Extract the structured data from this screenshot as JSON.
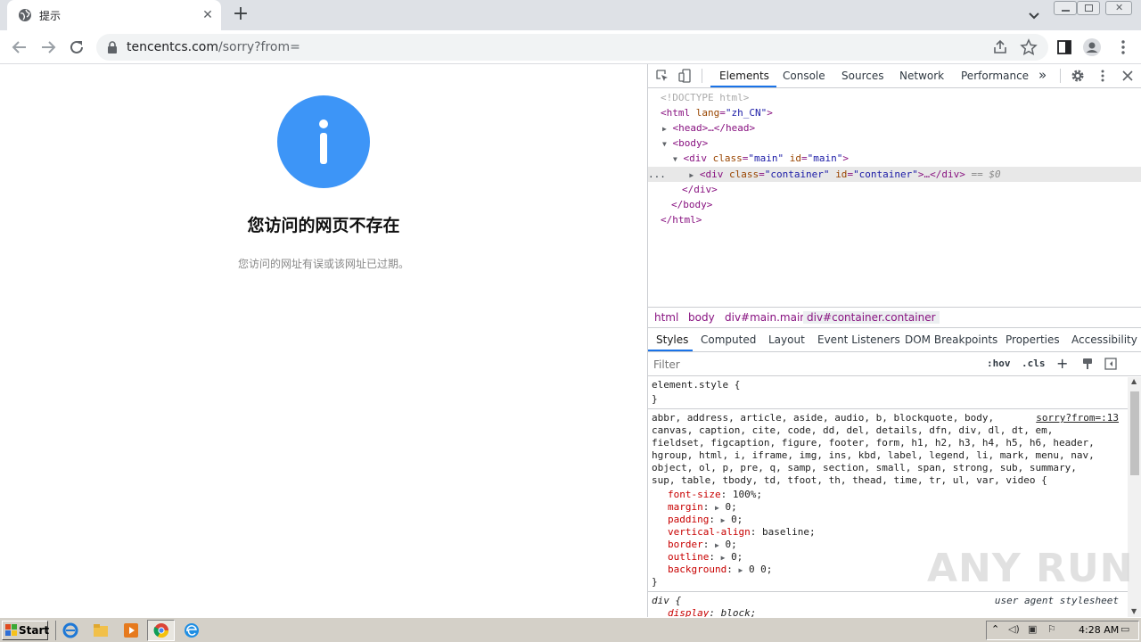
{
  "browser": {
    "tab_title": "提示",
    "url_host": "tencentcs.com",
    "url_rest": "/sorry?from="
  },
  "page": {
    "heading": "您访问的网页不存在",
    "subtext": "您访问的网址有误或该网址已过期。",
    "info_icon_color": "#3d95f7"
  },
  "devtools": {
    "tabs": [
      "Elements",
      "Console",
      "Sources",
      "Network",
      "Performance"
    ],
    "more_tabs": "»",
    "dom": {
      "doctype": "<!DOCTYPE html>",
      "html_open_tag": "html",
      "html_attr_name": "lang",
      "html_attr_value": "\"zh_CN\"",
      "head_line": "<head>…</head>",
      "body_open": "<body>",
      "main_tag": "div",
      "main_class_name": "class",
      "main_class_value": "\"main\"",
      "main_id_name": "id",
      "main_id_value": "\"main\"",
      "container_tag": "div",
      "container_class_value": "\"container\"",
      "container_id_value": "\"container\"",
      "container_suffix": ">…</div>",
      "selected_marker": "== $0",
      "ellipsis": "...",
      "div_close": "</div>",
      "body_close": "</body>",
      "html_close": "</html>"
    },
    "breadcrumbs": [
      "html",
      "body",
      "div#main.main",
      "div#container.container"
    ],
    "subtabs": [
      "Styles",
      "Computed",
      "Layout",
      "Event Listeners",
      "DOM Breakpoints",
      "Properties",
      "Accessibility"
    ],
    "filter_placeholder": "Filter",
    "hov": ":hov",
    "cls": ".cls",
    "styles": {
      "element_style": "element.style {",
      "close_brace": "}",
      "rule2_source": "sorry?from=:13",
      "rule2_selector_lines": [
        "abbr, address, article, aside, audio, b, blockquote, body,",
        "canvas, caption, cite, code, dd, del, details, dfn, div, dl, dt, em,",
        "fieldset, figcaption, figure, footer, form, h1, h2, h3, h4, h5, h6, header,",
        "hgroup, html, i, iframe, img, ins, kbd, label, legend, li, mark, menu, nav,",
        "object, ol, p, pre, q, samp, section, small, span, strong, sub, summary,",
        "sup, table, tbody, td, tfoot, th, thead, time, tr, ul, var, video {"
      ],
      "rule2_props": [
        {
          "name": "font-size",
          "value": "100%;",
          "expandable": false
        },
        {
          "name": "margin",
          "value": "0;",
          "expandable": true
        },
        {
          "name": "padding",
          "value": "0;",
          "expandable": true
        },
        {
          "name": "vertical-align",
          "value": "baseline;",
          "expandable": false
        },
        {
          "name": "border",
          "value": "0;",
          "expandable": true
        },
        {
          "name": "outline",
          "value": "0;",
          "expandable": true
        },
        {
          "name": "background",
          "value": "0 0;",
          "expandable": true
        }
      ],
      "rule3_selector": "div {",
      "rule3_source": "user agent stylesheet",
      "rule3_prop_name": "display",
      "rule3_prop_value": "block;"
    }
  },
  "watermark": "ANY RUN",
  "taskbar": {
    "start_label": "Start",
    "clock": "4:28 AM"
  }
}
